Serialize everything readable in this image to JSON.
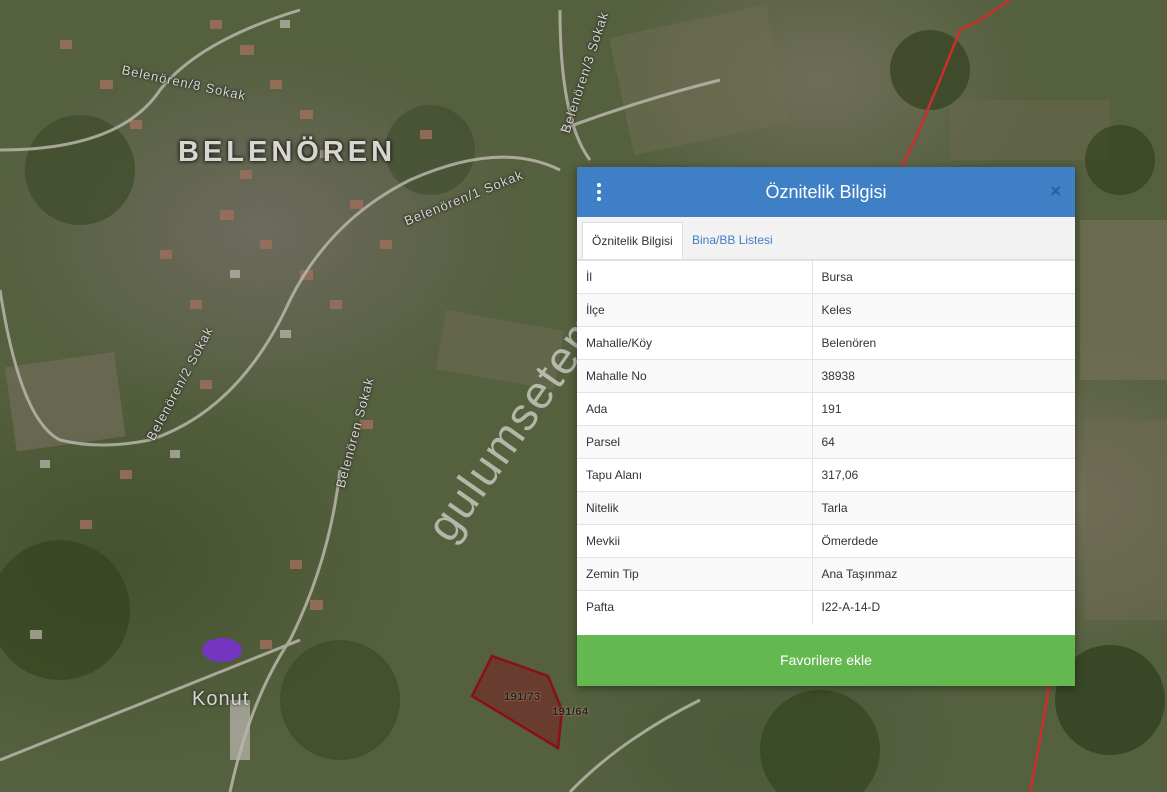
{
  "map": {
    "place_label": "BELENÖREN",
    "area_label": "Konut",
    "watermark": "gulumsetemlak.com",
    "streets": [
      {
        "name": "Belenören/8 Sokak"
      },
      {
        "name": "Belenören/2 Sokak"
      },
      {
        "name": "Belenören/1 Sokak"
      },
      {
        "name": "Belenören/3 Sokak"
      },
      {
        "name": "Belenören Sokak"
      }
    ],
    "parcel_labels": [
      "191/73",
      "191/64"
    ],
    "colors": {
      "parcel": "#7a1f24",
      "boundary": "#c9302c",
      "highlight": "#7b2fd8"
    }
  },
  "panel": {
    "title": "Öznitelik Bilgisi",
    "menu_icon": "vertical-ellipsis-icon",
    "close_icon": "close-icon",
    "close_glyph": "×",
    "tabs": [
      {
        "label": "Öznitelik Bilgisi",
        "active": true
      },
      {
        "label": "Bina/BB Listesi",
        "active": false
      }
    ],
    "rows": [
      {
        "key": "İl",
        "value": "Bursa"
      },
      {
        "key": "İlçe",
        "value": "Keles"
      },
      {
        "key": "Mahalle/Köy",
        "value": "Belenören"
      },
      {
        "key": "Mahalle No",
        "value": "38938"
      },
      {
        "key": "Ada",
        "value": "191"
      },
      {
        "key": "Parsel",
        "value": "64"
      },
      {
        "key": "Tapu Alanı",
        "value": "317,06"
      },
      {
        "key": "Nitelik",
        "value": "Tarla"
      },
      {
        "key": "Mevkii",
        "value": "Ömerdede"
      },
      {
        "key": "Zemin Tip",
        "value": "Ana Taşınmaz"
      },
      {
        "key": "Pafta",
        "value": "I22-A-14-D"
      }
    ],
    "favorite_button": "Favorilere ekle",
    "colors": {
      "header": "#3f7fc6",
      "button": "#63b94f"
    }
  }
}
